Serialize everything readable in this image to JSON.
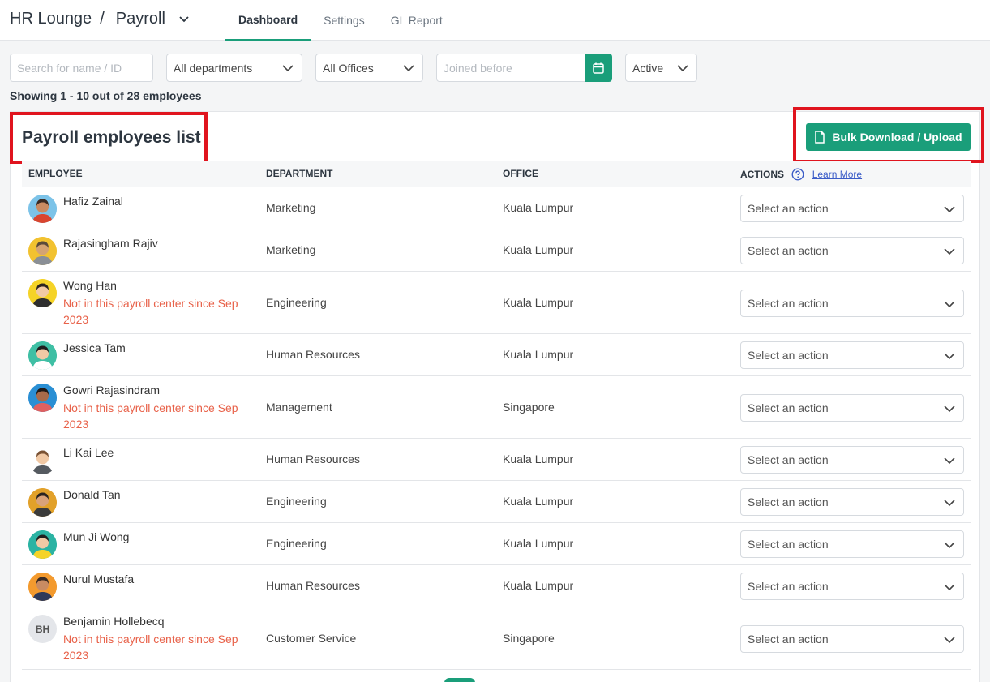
{
  "header": {
    "app_title": "HR Lounge",
    "separator": "/",
    "section": "Payroll",
    "tabs": [
      {
        "label": "Dashboard",
        "active": true
      },
      {
        "label": "Settings",
        "active": false
      },
      {
        "label": "GL Report",
        "active": false
      }
    ]
  },
  "filters": {
    "search_placeholder": "Search for name / ID",
    "department": "All departments",
    "office": "All Offices",
    "joined_placeholder": "Joined before",
    "status": "Active"
  },
  "summary": "Showing 1 - 10 out of 28 employees",
  "card": {
    "title": "Payroll employees list",
    "bulk_button": "Bulk Download / Upload"
  },
  "table": {
    "columns": {
      "employee": "EMPLOYEE",
      "department": "DEPARTMENT",
      "office": "OFFICE",
      "actions": "ACTIONS",
      "learn_more": "Learn More"
    },
    "action_placeholder": "Select an action",
    "rows": [
      {
        "name": "Hafiz Zainal",
        "note": "",
        "department": "Marketing",
        "office": "Kuala Lumpur",
        "avatar": "avatar-hafiz",
        "skin": "#c98b62",
        "hair": "#3a2a22",
        "bg": "#7cc3e8",
        "shirt": "#d9452f"
      },
      {
        "name": "Rajasingham Rajiv",
        "note": "",
        "department": "Marketing",
        "office": "Kuala Lumpur",
        "avatar": "avatar-rajiv",
        "skin": "#d4a373",
        "hair": "#5a4a3a",
        "bg": "#f2c230",
        "shirt": "#8a8f96"
      },
      {
        "name": "Wong Han",
        "note": "Not in this payroll center since Sep 2023",
        "department": "Engineering",
        "office": "Kuala Lumpur",
        "avatar": "avatar-wong",
        "skin": "#f1c9a5",
        "hair": "#2a2320",
        "bg": "#f5d327",
        "shirt": "#2e2e2e"
      },
      {
        "name": "Jessica Tam",
        "note": "",
        "department": "Human Resources",
        "office": "Kuala Lumpur",
        "avatar": "avatar-jessica",
        "skin": "#f1c9a5",
        "hair": "#1f1f1f",
        "bg": "#3fbfa4",
        "shirt": "#ffffff"
      },
      {
        "name": "Gowri Rajasindram",
        "note": "Not in this payroll center since Sep 2023",
        "department": "Management",
        "office": "Singapore",
        "avatar": "avatar-gowri",
        "skin": "#a86b4a",
        "hair": "#1f1a17",
        "bg": "#2a8fd4",
        "shirt": "#e06060"
      },
      {
        "name": "Li Kai Lee",
        "note": "",
        "department": "Human Resources",
        "office": "Kuala Lumpur",
        "avatar": "avatar-li",
        "skin": "#f1c9a5",
        "hair": "#7a5234",
        "bg": "#ffffff",
        "shirt": "#555a60"
      },
      {
        "name": "Donald Tan",
        "note": "",
        "department": "Engineering",
        "office": "Kuala Lumpur",
        "avatar": "avatar-donald",
        "skin": "#d9a27a",
        "hair": "#2a2320",
        "bg": "#e2a12a",
        "shirt": "#3b3b3b"
      },
      {
        "name": "Mun Ji Wong",
        "note": "",
        "department": "Engineering",
        "office": "Kuala Lumpur",
        "avatar": "avatar-munji",
        "skin": "#f1c9a5",
        "hair": "#1f1f1f",
        "bg": "#2bb3a3",
        "shirt": "#f5d327"
      },
      {
        "name": "Nurul Mustafa",
        "note": "",
        "department": "Human Resources",
        "office": "Kuala Lumpur",
        "avatar": "avatar-nurul",
        "skin": "#c98b62",
        "hair": "#3a2a22",
        "bg": "#f39a2e",
        "shirt": "#2e3a5a"
      },
      {
        "name": "Benjamin Hollebecq",
        "note": "Not in this payroll center since Sep 2023",
        "department": "Customer Service",
        "office": "Singapore",
        "avatar": "initials",
        "initials": "BH"
      }
    ]
  },
  "colors": {
    "accent": "#1a9e7a",
    "warning_text": "#e8624a",
    "highlight": "#e0141e"
  }
}
